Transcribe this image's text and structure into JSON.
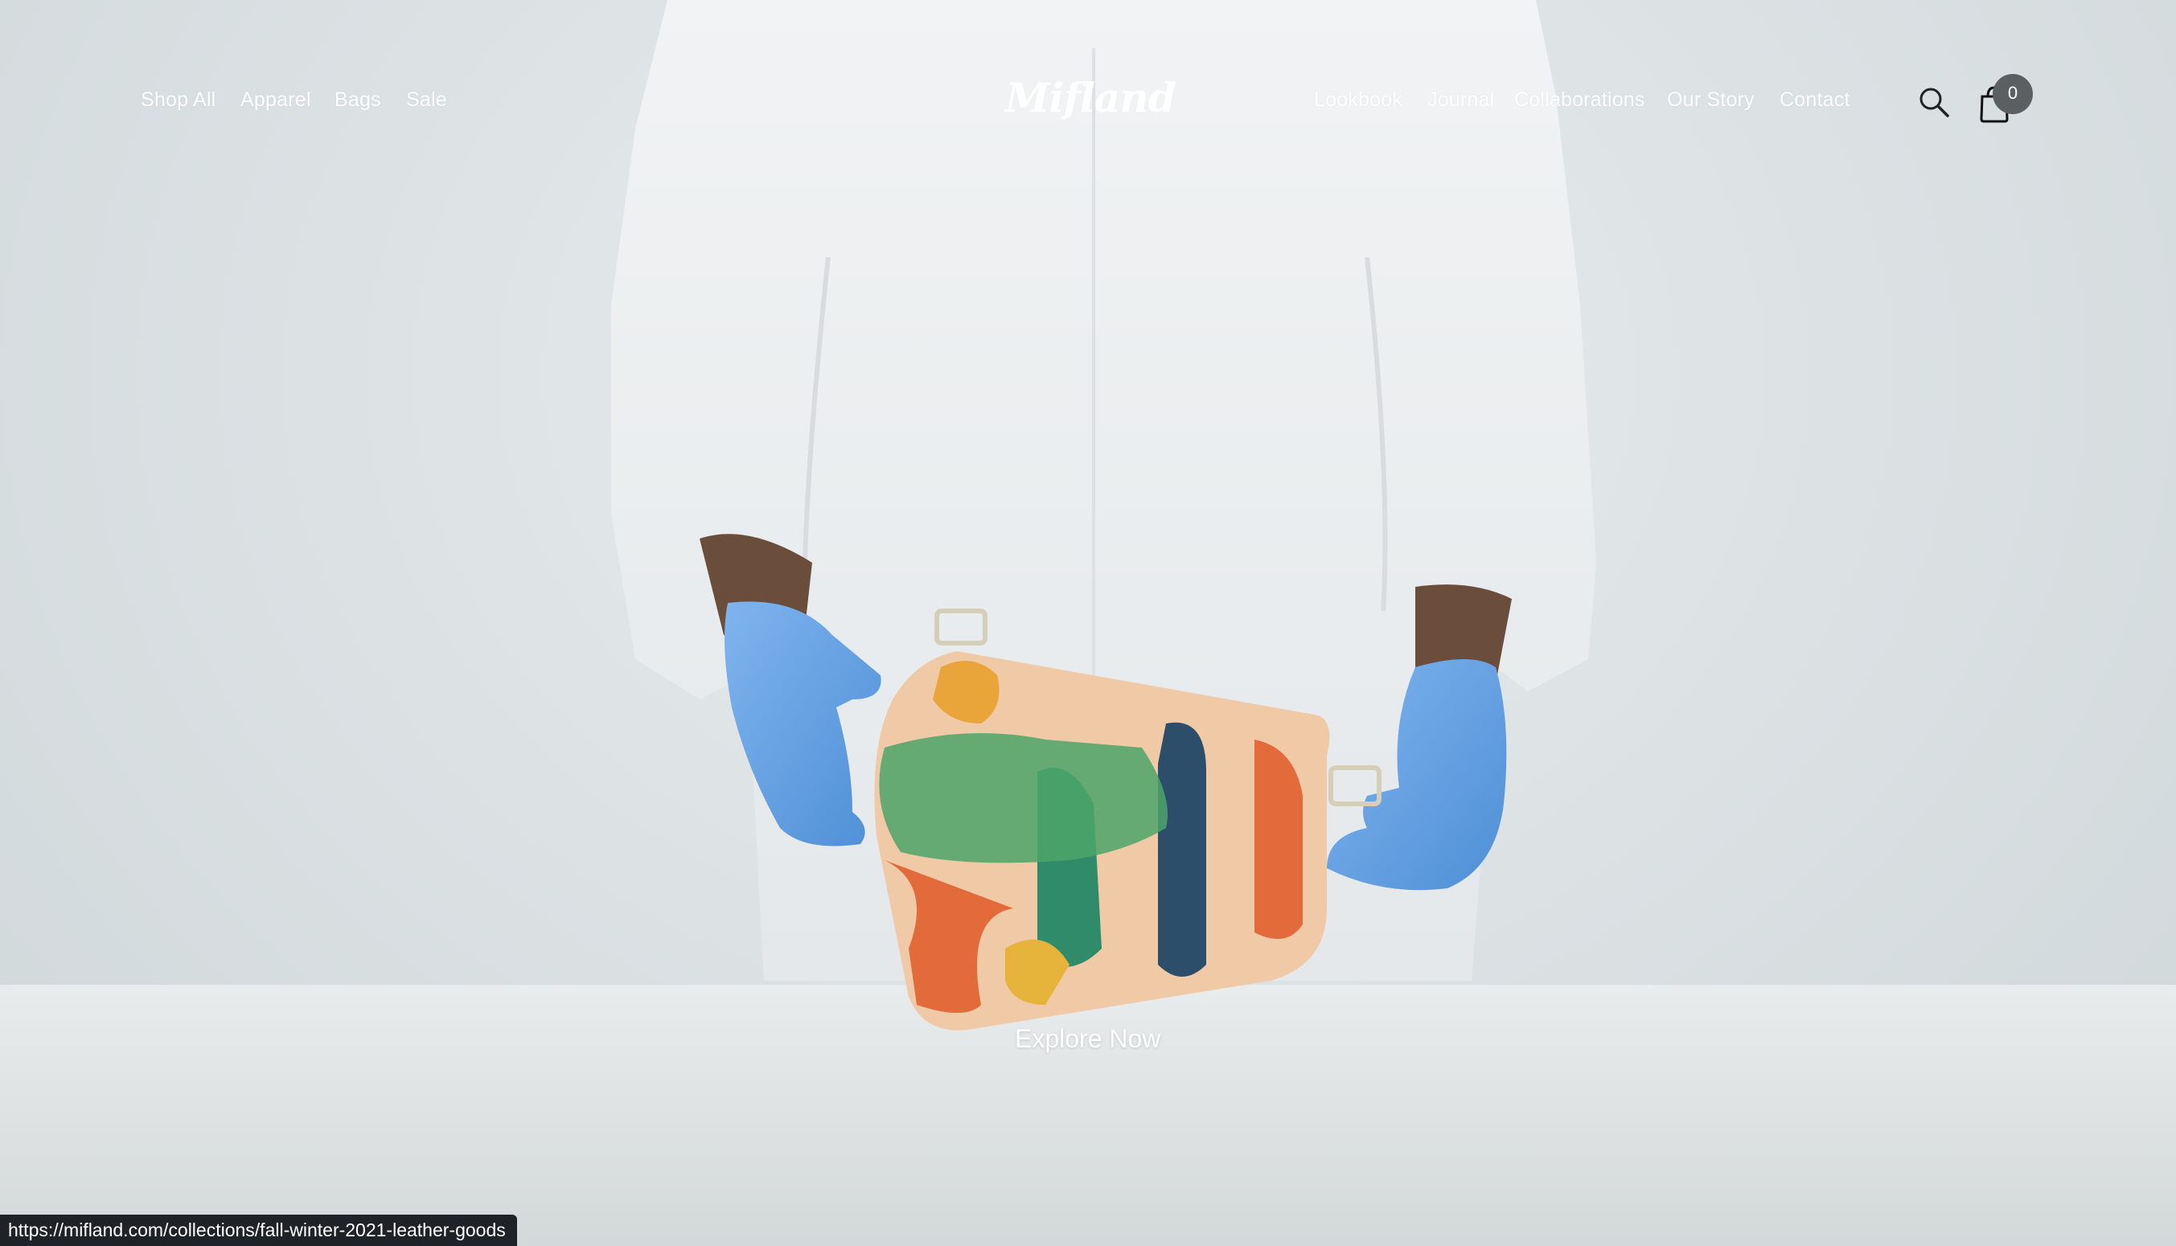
{
  "nav_left": [
    {
      "label": "Shop All"
    },
    {
      "label": "Apparel"
    },
    {
      "label": "Bags"
    },
    {
      "label": "Sale"
    }
  ],
  "logo": {
    "text": "Mifland"
  },
  "nav_right": [
    {
      "label": "Lookbook"
    },
    {
      "label": "Journal"
    },
    {
      "label": "Collaborations"
    },
    {
      "label": "Our Story"
    },
    {
      "label": "Contact"
    }
  ],
  "header_icons": {
    "search": "search-icon",
    "cart": "shopping-bag-icon"
  },
  "cart": {
    "count": "0"
  },
  "hero": {
    "cta_label": "Explore Now"
  },
  "status_bar": {
    "url": "https://mifland.com/collections/fall-winter-2021-leather-goods"
  },
  "colors": {
    "background": "#d9dfe1",
    "nav_text": "#ffffff",
    "cart_badge": "#5b5f62",
    "glove_blue": "#5f9fe0",
    "status_bar": "#1f2327"
  }
}
